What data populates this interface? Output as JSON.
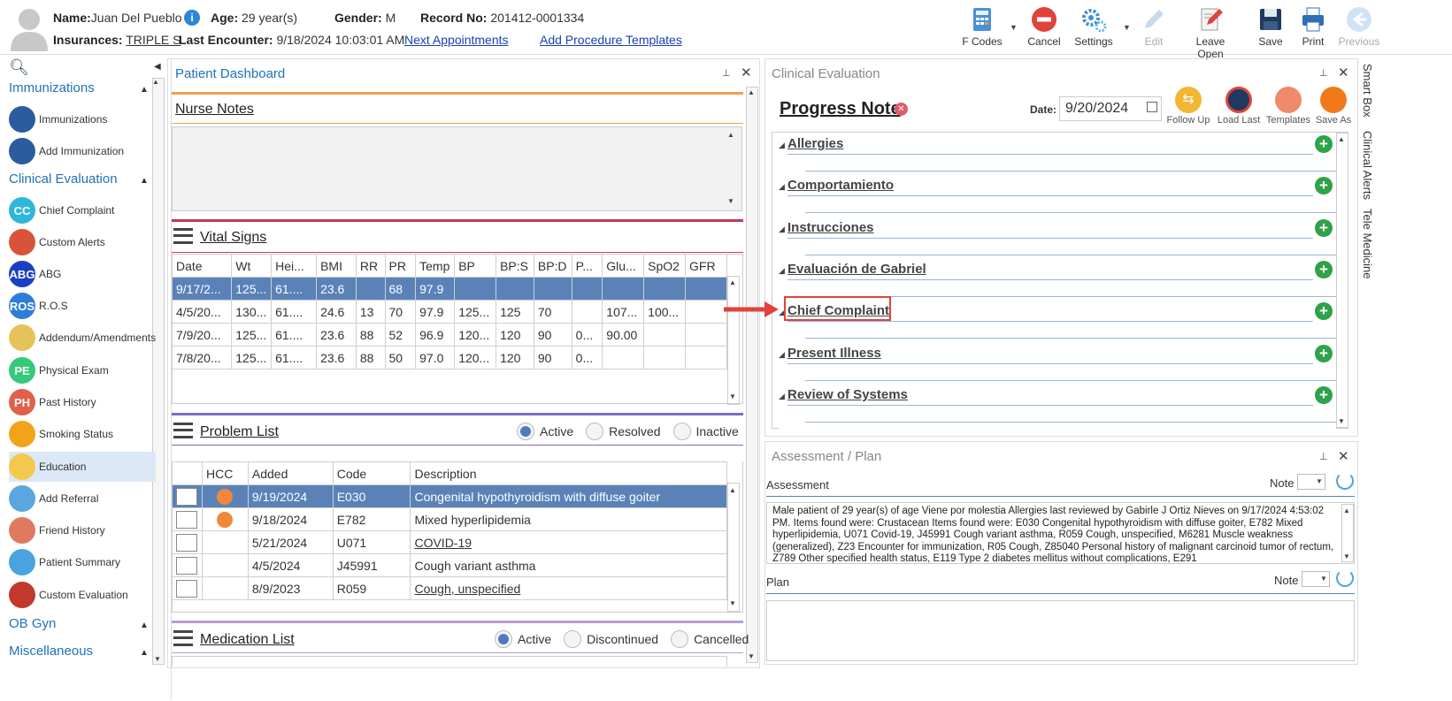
{
  "header": {
    "name_label": "Name:",
    "name_value": "Juan Del Pueblo",
    "age_label": "Age:",
    "age_value": "29 year(s)",
    "gender_label": "Gender:",
    "gender_value": "M",
    "record_label": "Record No:",
    "record_value": "201412-0001334",
    "insurances_label": "Insurances:",
    "insurances_value": "TRIPLE S",
    "last_encounter_label": "Last Encounter:",
    "last_encounter_value": "9/18/2024 10:03:01 AM",
    "next_appointments": "Next Appointments",
    "add_procedure_templates": "Add Procedure Templates"
  },
  "toolbar": {
    "fcodes": "F Codes",
    "cancel": "Cancel",
    "settings": "Settings",
    "edit": "Edit",
    "leave_open": "Leave Open",
    "save": "Save",
    "print": "Print",
    "previous": "Previous"
  },
  "sidebar": {
    "sections": {
      "immunizations": "Immunizations",
      "clinical_evaluation": "Clinical Evaluation",
      "ob_gyn": "OB Gyn",
      "miscellaneous": "Miscellaneous"
    },
    "items": [
      {
        "label": "Immunizations",
        "icon": "syringe-icon",
        "abbr": "",
        "color": "#2b5c9e"
      },
      {
        "label": "Add Immunization",
        "icon": "syringe-icon",
        "abbr": "",
        "color": "#2b5c9e"
      },
      {
        "label": "Chief Complaint",
        "icon": "cc-icon",
        "abbr": "CC",
        "color": "#2fb6d9"
      },
      {
        "label": "Custom Alerts",
        "icon": "bell-icon",
        "abbr": "",
        "color": "#d9533a"
      },
      {
        "label": "ABG",
        "icon": "abg-icon",
        "abbr": "ABG",
        "color": "#1a3fc2"
      },
      {
        "label": "R.O.S",
        "icon": "ros-icon",
        "abbr": "ROS",
        "color": "#2f7ed6"
      },
      {
        "label": "Addendum/Amendments",
        "icon": "document-icon",
        "abbr": "",
        "color": "#e6c35a"
      },
      {
        "label": "Physical Exam",
        "icon": "pe-icon",
        "abbr": "PE",
        "color": "#35c97a"
      },
      {
        "label": "Past History",
        "icon": "ph-icon",
        "abbr": "PH",
        "color": "#e0604a"
      },
      {
        "label": "Smoking Status",
        "icon": "no-smoking-icon",
        "abbr": "",
        "color": "#f2a31b"
      },
      {
        "label": "Education",
        "icon": "education-icon",
        "abbr": "",
        "color": "#f2c94c"
      },
      {
        "label": "Add Referral",
        "icon": "referral-icon",
        "abbr": "",
        "color": "#5aa7e0"
      },
      {
        "label": "Friend History",
        "icon": "friends-icon",
        "abbr": "",
        "color": "#e07a5f"
      },
      {
        "label": "Patient Summary",
        "icon": "summary-icon",
        "abbr": "",
        "color": "#4aa3df"
      },
      {
        "label": "Custom Evaluation",
        "icon": "stethoscope-icon",
        "abbr": "",
        "color": "#c0392b"
      }
    ]
  },
  "dashboard": {
    "title": "Patient Dashboard",
    "nurse_notes": "Nurse Notes",
    "vital_signs": "Vital Signs",
    "vitals_headers": [
      "Date",
      "Wt",
      "Hei...",
      "BMI",
      "RR",
      "PR",
      "Temp",
      "BP",
      "BP:S",
      "BP:D",
      "P...",
      "Glu...",
      "SpO2",
      "GFR"
    ],
    "vitals_rows": [
      [
        "9/17/2...",
        "125...",
        "61....",
        "23.6",
        "",
        "68",
        "97.9",
        "",
        "",
        "",
        "",
        "",
        "",
        ""
      ],
      [
        "4/5/20...",
        "130...",
        "61....",
        "24.6",
        "13",
        "70",
        "97.9",
        "125...",
        "125",
        "70",
        "",
        "107...",
        "100...",
        ""
      ],
      [
        "7/9/20...",
        "125...",
        "61....",
        "23.6",
        "88",
        "52",
        "96.9",
        "120...",
        "120",
        "90",
        "0...",
        "90.00",
        "",
        ""
      ],
      [
        "7/8/20...",
        "125...",
        "61....",
        "23.6",
        "88",
        "50",
        "97.0",
        "120...",
        "120",
        "90",
        "0...",
        "",
        "",
        ""
      ]
    ],
    "problem_list": "Problem List",
    "problem_filters": [
      "Active",
      "Resolved",
      "Inactive"
    ],
    "problem_headers": [
      "",
      "HCC",
      "Added",
      "Code",
      "Description"
    ],
    "problem_rows": [
      {
        "hcc": true,
        "added": "9/19/2024",
        "code": "E030",
        "desc": "Congenital hypothyroidism with diffuse goiter",
        "link": false
      },
      {
        "hcc": true,
        "added": "9/18/2024",
        "code": "E782",
        "desc": "Mixed hyperlipidemia",
        "link": false
      },
      {
        "hcc": false,
        "added": "5/21/2024",
        "code": "U071",
        "desc": "COVID-19",
        "link": true
      },
      {
        "hcc": false,
        "added": "4/5/2024",
        "code": "J45991",
        "desc": "Cough variant asthma",
        "link": false
      },
      {
        "hcc": false,
        "added": "8/9/2023",
        "code": "R059",
        "desc": "Cough, unspecified",
        "link": true
      }
    ],
    "medication_list": "Medication List",
    "medication_filters": [
      "Active",
      "Discontinued",
      "Cancelled"
    ]
  },
  "clinical": {
    "title": "Clinical Evaluation",
    "progress_note": "Progress Note",
    "date_label": "Date:",
    "date_value": "9/20/2024",
    "actions": [
      "Follow Up",
      "Load Last",
      "Templates",
      "Save As"
    ],
    "sections": [
      "Allergies",
      "Comportamiento",
      "Instrucciones",
      "Evaluación de Gabriel",
      "Chief Complaint",
      "Present Illness",
      "Review of Systems"
    ]
  },
  "side_tabs": [
    "Smart Box",
    "Clinical Alerts",
    "Tele Medicine"
  ],
  "assessment": {
    "title": "Assessment / Plan",
    "assessment_label": "Assessment",
    "note_label": "Note",
    "text": "Male patient of 29 year(s) of age Viene por molestia     Allergies last reviewed by Gabirle J Ortiz Nieves on 9/17/2024 4:53:02 PM.    Items found were:  Crustacean  Items found were:  E030 Congenital hypothyroidism with diffuse goiter, E782 Mixed hyperlipidemia, U071 Covid-19, J45991 Cough variant asthma, R059 Cough, unspecified, M6281 Muscle weakness (generalized), Z23 Encounter for immunization, R05 Cough, Z85040 Personal history of malignant carcinoid tumor of rectum, Z789 Other specified health status, E119 Type 2 diabetes mellitus without complications, E291",
    "plan_label": "Plan"
  },
  "colors": {
    "accent": "#1f72b8",
    "highlight_row": "#5a82b8",
    "highlight_box": "#e0433a",
    "plus_green": "#2fa24a"
  }
}
